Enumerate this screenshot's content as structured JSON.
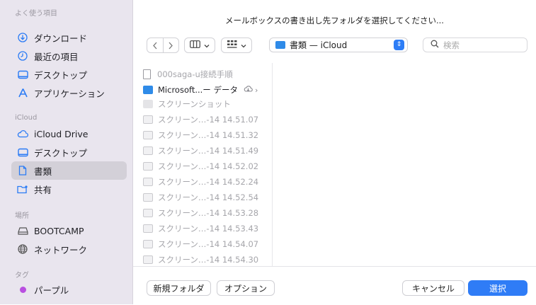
{
  "dialog": {
    "title": "メールボックスの書き出し先フォルダを選択してください..."
  },
  "sidebar": {
    "favorites_title": "よく使う項目",
    "favorites": [
      {
        "label": "ダウンロード",
        "icon": "download-icon"
      },
      {
        "label": "最近の項目",
        "icon": "clock-icon"
      },
      {
        "label": "デスクトップ",
        "icon": "desktop-icon"
      },
      {
        "label": "アプリケーション",
        "icon": "applications-icon"
      }
    ],
    "icloud_title": "iCloud",
    "icloud": [
      {
        "label": "iCloud Drive",
        "icon": "cloud-icon"
      },
      {
        "label": "デスクトップ",
        "icon": "desktop-icon"
      },
      {
        "label": "書類",
        "icon": "document-icon",
        "selected": true
      },
      {
        "label": "共有",
        "icon": "shared-folder-icon"
      }
    ],
    "locations_title": "場所",
    "locations": [
      {
        "label": "BOOTCAMP",
        "icon": "disk-icon"
      },
      {
        "label": "ネットワーク",
        "icon": "network-icon"
      }
    ],
    "tags_title": "タグ",
    "tags": [
      {
        "label": "パープル",
        "color": "#b94fe0"
      }
    ]
  },
  "toolbar": {
    "location": "書類 — iCloud",
    "search_placeholder": "検索"
  },
  "files": [
    {
      "name": "000saga-u接続手順",
      "type": "doc",
      "state": "dim"
    },
    {
      "name": "Microsoft...ー データ",
      "type": "folder",
      "state": "bright",
      "cloud": true
    },
    {
      "name": "スクリーンショット",
      "type": "gray",
      "state": "dim"
    },
    {
      "name": "スクリーン…-14 14.51.07",
      "type": "img",
      "state": "dim"
    },
    {
      "name": "スクリーン…-14 14.51.32",
      "type": "img",
      "state": "dim"
    },
    {
      "name": "スクリーン…-14 14.51.49",
      "type": "img",
      "state": "dim"
    },
    {
      "name": "スクリーン…-14 14.52.02",
      "type": "img",
      "state": "dim"
    },
    {
      "name": "スクリーン…-14 14.52.24",
      "type": "img",
      "state": "dim"
    },
    {
      "name": "スクリーン…-14 14.52.54",
      "type": "img",
      "state": "dim"
    },
    {
      "name": "スクリーン…-14 14.53.28",
      "type": "img",
      "state": "dim"
    },
    {
      "name": "スクリーン…-14 14.53.43",
      "type": "img",
      "state": "dim"
    },
    {
      "name": "スクリーン…-14 14.54.07",
      "type": "img",
      "state": "dim"
    },
    {
      "name": "スクリーン…-14 14.54.30",
      "type": "img",
      "state": "dim"
    }
  ],
  "buttons": {
    "new_folder": "新規フォルダ",
    "options": "オプション",
    "cancel": "キャンセル",
    "select": "選択"
  },
  "colors": {
    "accent": "#2f7cf6",
    "sidebar_bg": "#e9e5ee",
    "tag_purple": "#b94fe0"
  }
}
